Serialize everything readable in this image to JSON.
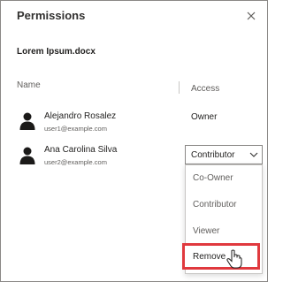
{
  "dialog": {
    "title": "Permissions",
    "document_name": "Lorem Ipsum.docx",
    "close_icon": "close-icon"
  },
  "columns": {
    "name": "Name",
    "access": "Access"
  },
  "users": [
    {
      "name": "Alejandro Rosalez",
      "email": "user1@example.com",
      "access": "Owner",
      "icon": "user-icon"
    },
    {
      "name": "Ana Carolina Silva",
      "email": "user2@example.com",
      "access": "Contributor",
      "icon": "user-icon"
    }
  ],
  "access_dropdown": {
    "selected": "Contributor",
    "options": [
      "Co-Owner",
      "Contributor",
      "Viewer",
      "Remove"
    ],
    "highlighted_option": "Remove"
  },
  "colors": {
    "border": "#8a8886",
    "highlight": "#e0393e",
    "text": "#201f1e",
    "muted_text": "#605e5c"
  }
}
